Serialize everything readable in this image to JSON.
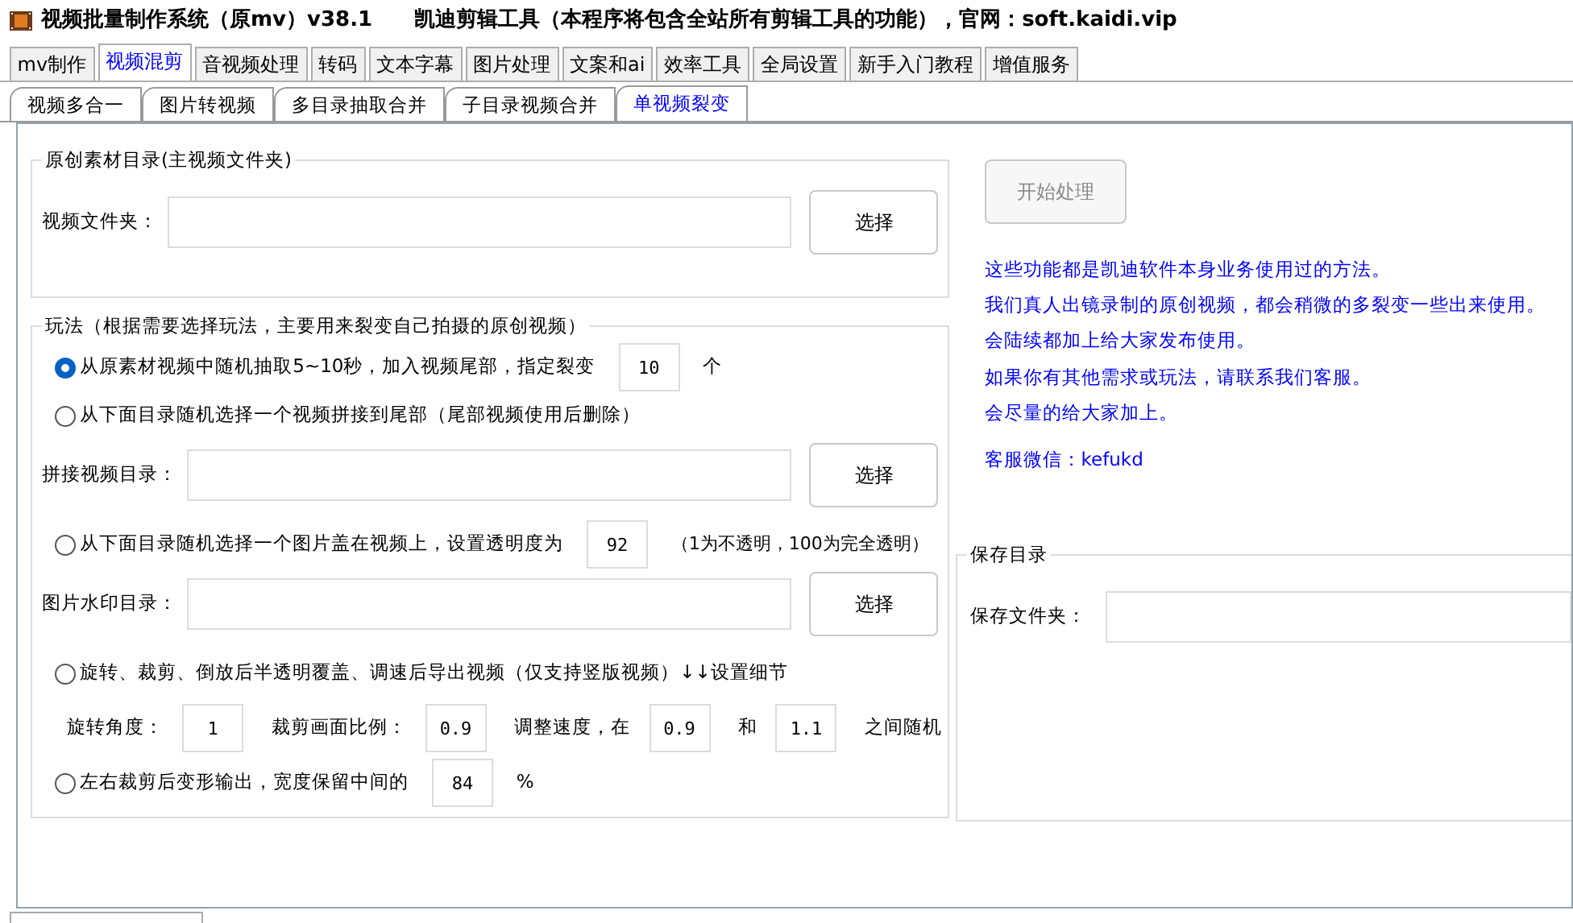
{
  "window": {
    "title": "视频批量制作系统（原mv）v38.1　　凯迪剪辑工具（本程序将包含全站所有剪辑工具的功能），官网：soft.kaidi.vip"
  },
  "main_tabs": [
    {
      "label": "mv制作",
      "selected": false
    },
    {
      "label": "视频混剪",
      "selected": true
    },
    {
      "label": "音视频处理",
      "selected": false
    },
    {
      "label": "转码",
      "selected": false
    },
    {
      "label": "文本字幕",
      "selected": false
    },
    {
      "label": "图片处理",
      "selected": false
    },
    {
      "label": "文案和ai",
      "selected": false
    },
    {
      "label": "效率工具",
      "selected": false
    },
    {
      "label": "全局设置",
      "selected": false
    },
    {
      "label": "新手入门教程",
      "selected": false
    },
    {
      "label": "增值服务",
      "selected": false
    }
  ],
  "sub_tabs": [
    {
      "label": "视频多合一",
      "selected": false
    },
    {
      "label": "图片转视频",
      "selected": false
    },
    {
      "label": "多目录抽取合并",
      "selected": false
    },
    {
      "label": "子目录视频合并",
      "selected": false
    },
    {
      "label": "单视频裂变",
      "selected": true
    }
  ],
  "source_group": {
    "title": "原创素材目录(主视频文件夹)",
    "field_label": "视频文件夹：",
    "button": "选择"
  },
  "play_group": {
    "title": "玩法（根据需要选择玩法，主要用来裂变自己拍摄的原创视频）",
    "options": [
      {
        "selected": true,
        "label": "从原素材视频中随机抽取5~10秒，加入视频尾部，指定裂变",
        "extras": [
          {
            "kind": "field",
            "value": "10"
          },
          {
            "kind": "text",
            "text": "个"
          }
        ]
      },
      {
        "selected": false,
        "label": "从下面目录随机选择一个视频拼接到尾部（尾部视频使用后删除）",
        "folder": {
          "label": "拼接视频目录：",
          "button": "选择"
        }
      },
      {
        "selected": false,
        "label": "从下面目录随机选择一个图片盖在视频上，设置透明度为",
        "extras": [
          {
            "kind": "field",
            "value": "92"
          },
          {
            "kind": "note",
            "text": "（1为不透明，100为完全透明）"
          }
        ],
        "folder": {
          "label": "图片水印目录：",
          "button": "选择"
        }
      },
      {
        "selected": false,
        "label": "旋转、裁剪、倒放后半透明覆盖、调速后导出视频（仅支持竖版视频）↓↓设置细节",
        "params": [
          {
            "kind": "text",
            "text": "旋转角度："
          },
          {
            "kind": "field",
            "value": "1"
          },
          {
            "kind": "text",
            "text": "裁剪画面比例："
          },
          {
            "kind": "field",
            "value": "0.9"
          },
          {
            "kind": "text",
            "text": "调整速度，在"
          },
          {
            "kind": "field",
            "value": "0.9"
          },
          {
            "kind": "text",
            "text": "和"
          },
          {
            "kind": "field",
            "value": "1.1"
          },
          {
            "kind": "text",
            "text": "之间随机"
          }
        ]
      },
      {
        "selected": false,
        "label": "左右裁剪后变形输出，宽度保留中间的",
        "extras": [
          {
            "kind": "field",
            "value": "84"
          },
          {
            "kind": "text",
            "text": "%"
          }
        ]
      }
    ]
  },
  "start_button": {
    "label": "开始处理",
    "disabled": true
  },
  "notes": [
    "这些功能都是凯迪软件本身业务使用过的方法。",
    "我们真人出镜录制的原创视频，都会稍微的多裂变一些出来使用。",
    "会陆续都加上给大家发布使用。",
    "如果你有其他需求或玩法，请联系我们客服。",
    "会尽量的给大家加上。"
  ],
  "contact": "客服微信：kefukd",
  "save_group": {
    "title": "保存目录",
    "field_label": "保存文件夹："
  }
}
